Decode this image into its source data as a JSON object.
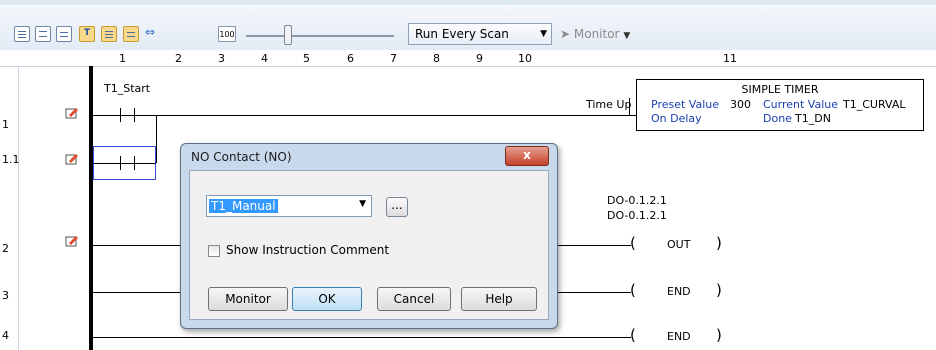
{
  "toolbar": {
    "icons": [
      "list-view",
      "ladder-view",
      "grid-view",
      "text-mode",
      "table-mode",
      "rung-mode",
      "arrows",
      "zoom"
    ],
    "zoom_label": "100",
    "execution_select": "Run Every Scan",
    "monitor_label": "Monitor",
    "colors": {
      "selected": "#f8d98c",
      "toolbar_bg": "#e3ebf5"
    }
  },
  "ruler": {
    "columns": [
      "1",
      "2",
      "3",
      "4",
      "5",
      "6",
      "7",
      "8",
      "9",
      "10",
      "11"
    ]
  },
  "rungs": {
    "r1": "1",
    "r1_1": "1.1",
    "r2": "2",
    "r3": "3",
    "r4": "4"
  },
  "ladder": {
    "contact_t1_start": "T1_Start",
    "time_up": "Time Up",
    "out_address_1": "DO-0.1.2.1",
    "out_address_2": "DO-0.1.2.1",
    "coil_out": "OUT",
    "coil_end_1": "END",
    "coil_end_2": "END",
    "paren_open": "(",
    "paren_close": ")"
  },
  "timer": {
    "title": "SIMPLE TIMER",
    "preset_label": "Preset Value",
    "preset_value": "300",
    "current_label": "Current Value",
    "current_value": "T1_CURVAL",
    "ondelay_label": "On Delay",
    "done_label": "Done",
    "done_value": "T1_DN"
  },
  "dialog": {
    "title": "NO Contact (NO)",
    "close": "x",
    "tag_value": "T1_Manual",
    "browse": "...",
    "show_comment": "Show Instruction Comment",
    "btn_monitor": "Monitor",
    "btn_ok": "OK",
    "btn_cancel": "Cancel",
    "btn_help": "Help"
  }
}
